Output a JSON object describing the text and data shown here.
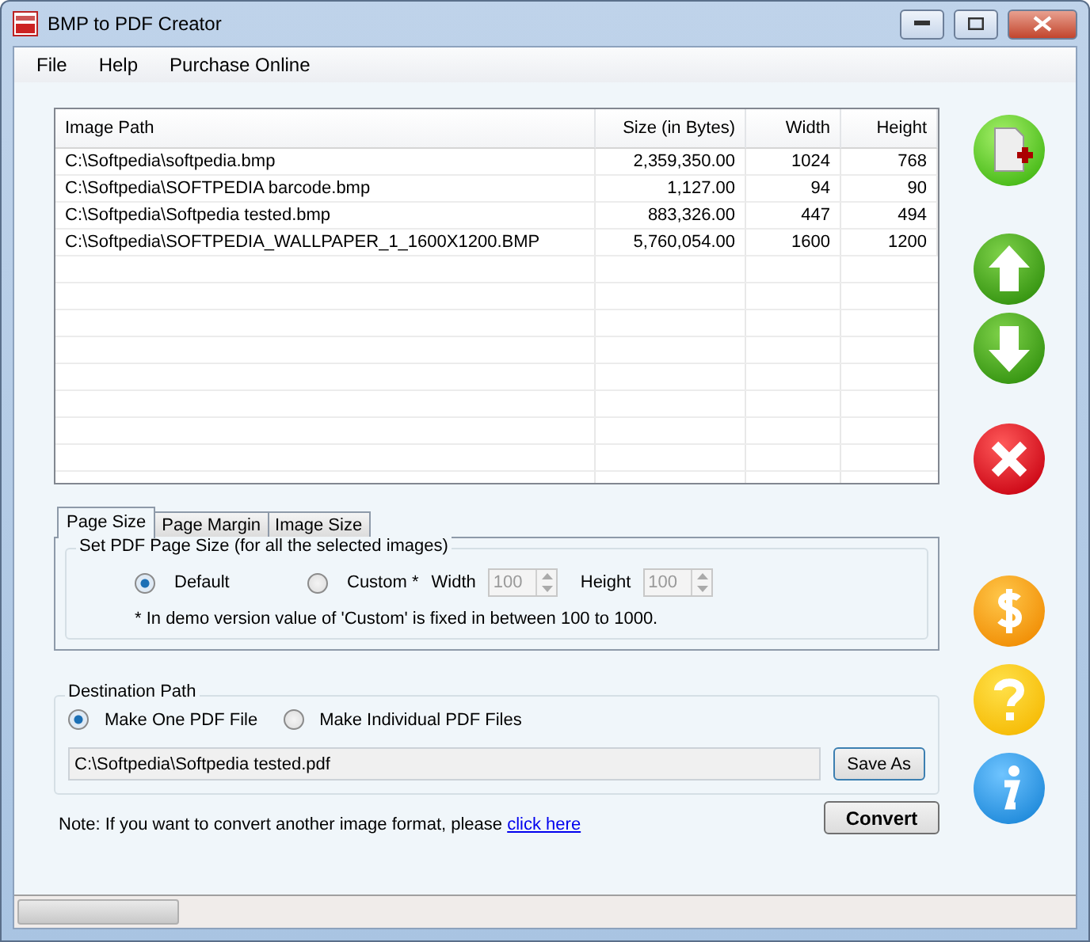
{
  "window": {
    "title": "BMP to PDF Creator"
  },
  "menu": [
    "File",
    "Help",
    "Purchase Online"
  ],
  "table": {
    "columns": [
      "Image Path",
      "Size (in Bytes)",
      "Width",
      "Height"
    ],
    "rows": [
      [
        "C:\\Softpedia\\softpedia.bmp",
        "2,359,350.00",
        "1024",
        "768"
      ],
      [
        "C:\\Softpedia\\SOFTPEDIA barcode.bmp",
        "1,127.00",
        "94",
        "90"
      ],
      [
        "C:\\Softpedia\\Softpedia tested.bmp",
        "883,326.00",
        "447",
        "494"
      ],
      [
        "C:\\Softpedia\\SOFTPEDIA_WALLPAPER_1_1600X1200.BMP",
        "5,760,054.00",
        "1600",
        "1200"
      ]
    ]
  },
  "tabs": [
    {
      "label": "Page Size",
      "selected": true
    },
    {
      "label": "Page Margin",
      "selected": false
    },
    {
      "label": "Image Size",
      "selected": false
    }
  ],
  "page_size": {
    "legend": "Set PDF Page Size (for all the selected images)",
    "options": [
      {
        "label": "Default",
        "selected": true
      },
      {
        "label": "Custom *",
        "selected": false
      }
    ],
    "width_label": "Width",
    "width_value": "100",
    "height_label": "Height",
    "height_value": "100",
    "note": "* In demo version value of 'Custom' is fixed in between 100 to 1000."
  },
  "destination": {
    "legend": "Destination Path",
    "options": [
      {
        "label": "Make One PDF File",
        "selected": true
      },
      {
        "label": "Make Individual PDF Files",
        "selected": false
      }
    ],
    "path": "C:\\Softpedia\\Softpedia tested.pdf",
    "save_button": "Save As"
  },
  "note": {
    "text": "Note: If you want to convert another image format, please ",
    "link": "click here"
  },
  "convert_button": "Convert"
}
